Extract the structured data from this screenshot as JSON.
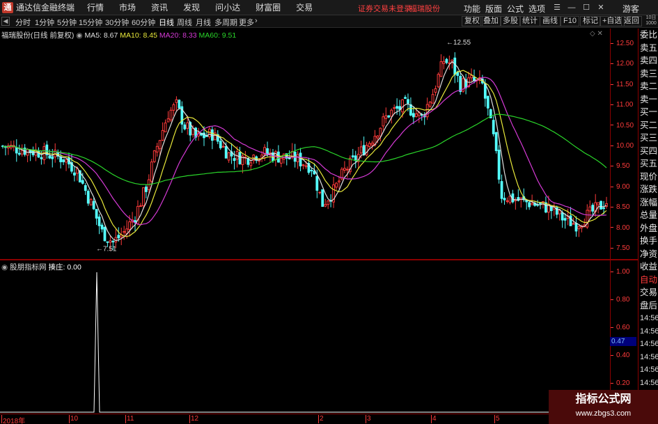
{
  "menubar": {
    "app_title": "通达信金融终端",
    "menu_items": [
      "行情",
      "市场",
      "资讯",
      "发现",
      "问小达",
      "财富圈",
      "交易"
    ],
    "notice": "证券交易未登录",
    "stock_name": "福瑞股份",
    "right_menu": [
      "功能",
      "版面",
      "公式",
      "选项"
    ],
    "guest": "游客"
  },
  "toolbar": {
    "periods": [
      "分时",
      "1分钟",
      "5分钟",
      "15分钟",
      "30分钟",
      "60分钟",
      "日线",
      "周线",
      "月线",
      "多周期",
      "更多"
    ],
    "active_period": "日线",
    "tools": [
      "复权",
      "叠加",
      "多股",
      "统计",
      "画线",
      "F10",
      "标记",
      "+自选",
      "返回"
    ],
    "corner_text": "10日 1000"
  },
  "main_chart": {
    "stock_label": "福瑞股份(日线 前复权)",
    "ma_indicators": [
      {
        "name": "MA5",
        "value": "8.67",
        "color": "#e0e0e0"
      },
      {
        "name": "MA10",
        "value": "8.45",
        "color": "#e8e83a"
      },
      {
        "name": "MA20",
        "value": "8.33",
        "color": "#d63ad6"
      },
      {
        "name": "MA60",
        "value": "9.51",
        "color": "#2ad62a"
      }
    ],
    "high_marker": "12.55",
    "low_marker": "7.51"
  },
  "price_axis": [
    "12.50",
    "12.00",
    "11.50",
    "11.00",
    "10.50",
    "10.00",
    "9.50",
    "9.00",
    "8.50",
    "8.00",
    "7.50"
  ],
  "sub_chart": {
    "indicator_name": "股朋指标网",
    "param_label": "揍庄:",
    "param_value": "0.00",
    "flag_value": "0.47"
  },
  "sub_axis": [
    "1.00",
    "0.80",
    "0.60",
    "0.40",
    "0.20"
  ],
  "quote_panel": {
    "labels": [
      "委比",
      "卖五",
      "卖四",
      "卖三",
      "卖二",
      "卖一",
      "买一",
      "买二",
      "买三",
      "买四",
      "买五",
      "现价",
      "涨跌",
      "涨幅",
      "总量",
      "外盘",
      "换手",
      "净资",
      "收益",
      "自动",
      "交易",
      "盘后"
    ],
    "times": [
      "14:56",
      "14:56",
      "14:56",
      "14:56",
      "14:56",
      "14:56",
      "14:56",
      "14:56"
    ]
  },
  "timeline": [
    "2018年",
    "10",
    "11",
    "12",
    "2",
    "3",
    "4",
    "5"
  ],
  "watermark": {
    "title": "指标公式网",
    "url": "www.zbgs3.com"
  },
  "colors": {
    "up": "#ff3b3b",
    "down": "#54ffff",
    "ma5": "#e0e0e0",
    "ma10": "#e8e83a",
    "ma20": "#d63ad6",
    "ma60": "#2ad62a"
  }
}
